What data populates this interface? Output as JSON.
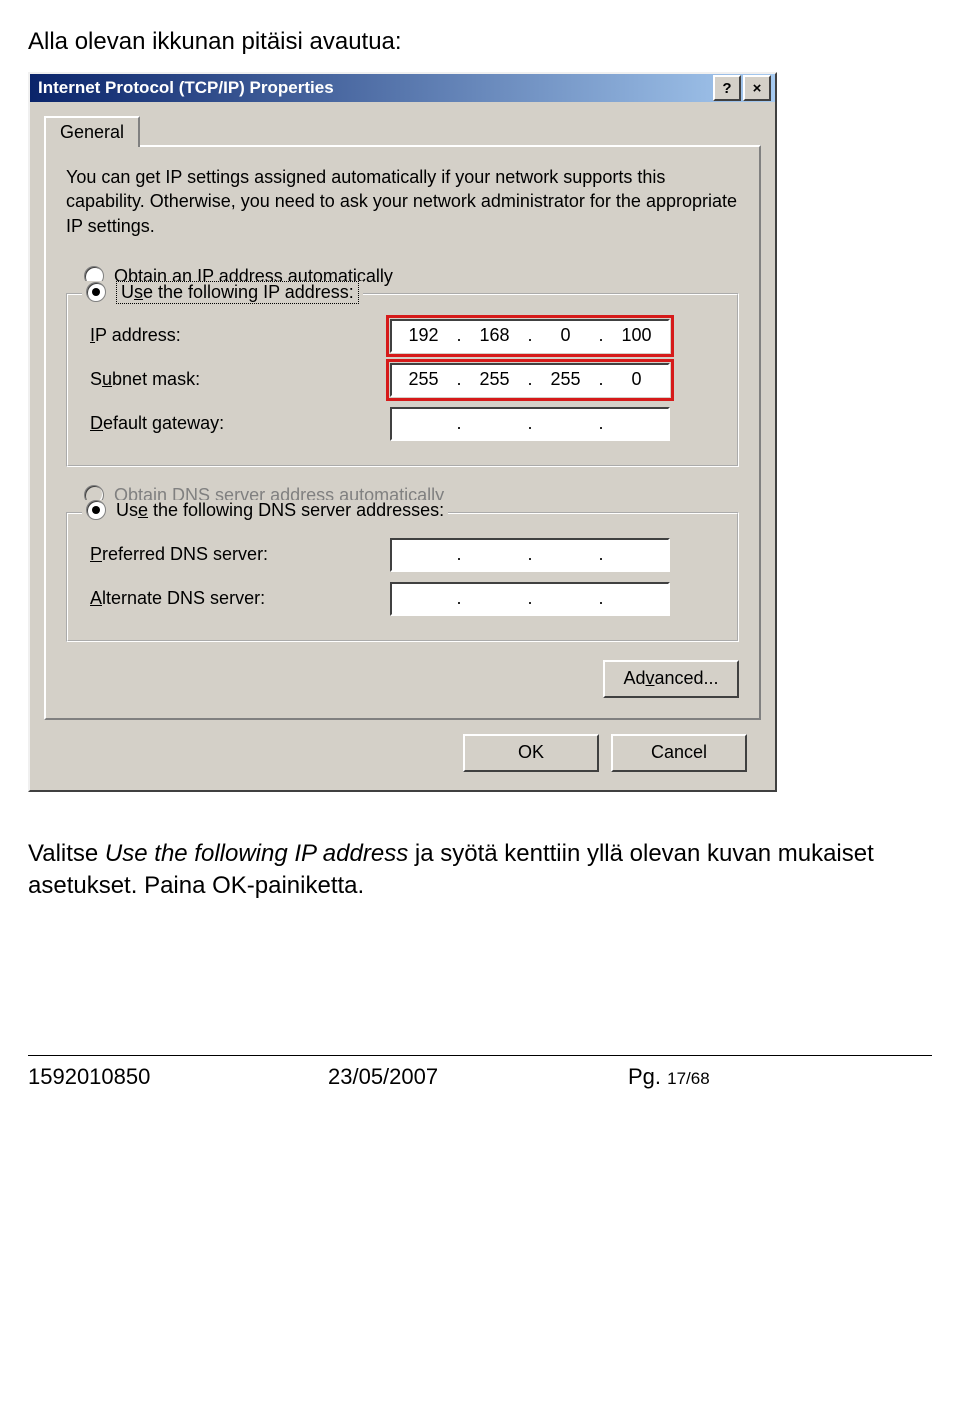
{
  "intro": "Alla olevan ikkunan pitäisi avautua:",
  "dialog": {
    "title": "Internet Protocol (TCP/IP) Properties",
    "help_label": "?",
    "close_label": "×",
    "tab": "General",
    "desc": "You can get IP settings assigned automatically if your network supports this capability. Otherwise, you need to ask your network administrator for the appropriate IP settings.",
    "radio_auto_ip": {
      "accel": "O",
      "rest": "btain an IP address automatically"
    },
    "radio_use_ip": {
      "text_before": "Use the following IP address:",
      "accel": "s"
    },
    "fields": {
      "ip_label": {
        "accel": "I",
        "rest": "P address:"
      },
      "subnet_label": {
        "text": "S",
        "accel": "u",
        "rest": "bnet mask:"
      },
      "gateway_label": {
        "accel": "D",
        "rest": "efault gateway:"
      },
      "ip_value": [
        "192",
        "168",
        "0",
        "100"
      ],
      "subnet_value": [
        "255",
        "255",
        "255",
        "0"
      ],
      "gateway_value": [
        "",
        "",
        "",
        ""
      ]
    },
    "radio_auto_dns": {
      "text_before": "O",
      "accel": "b",
      "rest": "tain DNS server address automatically"
    },
    "radio_use_dns": {
      "text_before": "Us",
      "accel": "e",
      "rest": " the following DNS server addresses:"
    },
    "dns_fields": {
      "pref_label": {
        "accel": "P",
        "rest": "referred DNS server:"
      },
      "alt_label": {
        "accel": "A",
        "rest": "lternate DNS server:"
      },
      "pref_value": [
        "",
        "",
        "",
        ""
      ],
      "alt_value": [
        "",
        "",
        "",
        ""
      ]
    },
    "advanced_label": {
      "text": "Ad",
      "accel": "v",
      "rest": "anced..."
    },
    "ok_label": "OK",
    "cancel_label": "Cancel"
  },
  "after": {
    "pre": "Valitse ",
    "italic": "Use the following IP address",
    "post": " ja syötä kenttiin yllä olevan kuvan mukaiset asetukset. Paina OK-painiketta."
  },
  "footer": {
    "doc": "1592010850",
    "date": "23/05/2007",
    "pg_label": "Pg. ",
    "pg_num": "17/68"
  }
}
